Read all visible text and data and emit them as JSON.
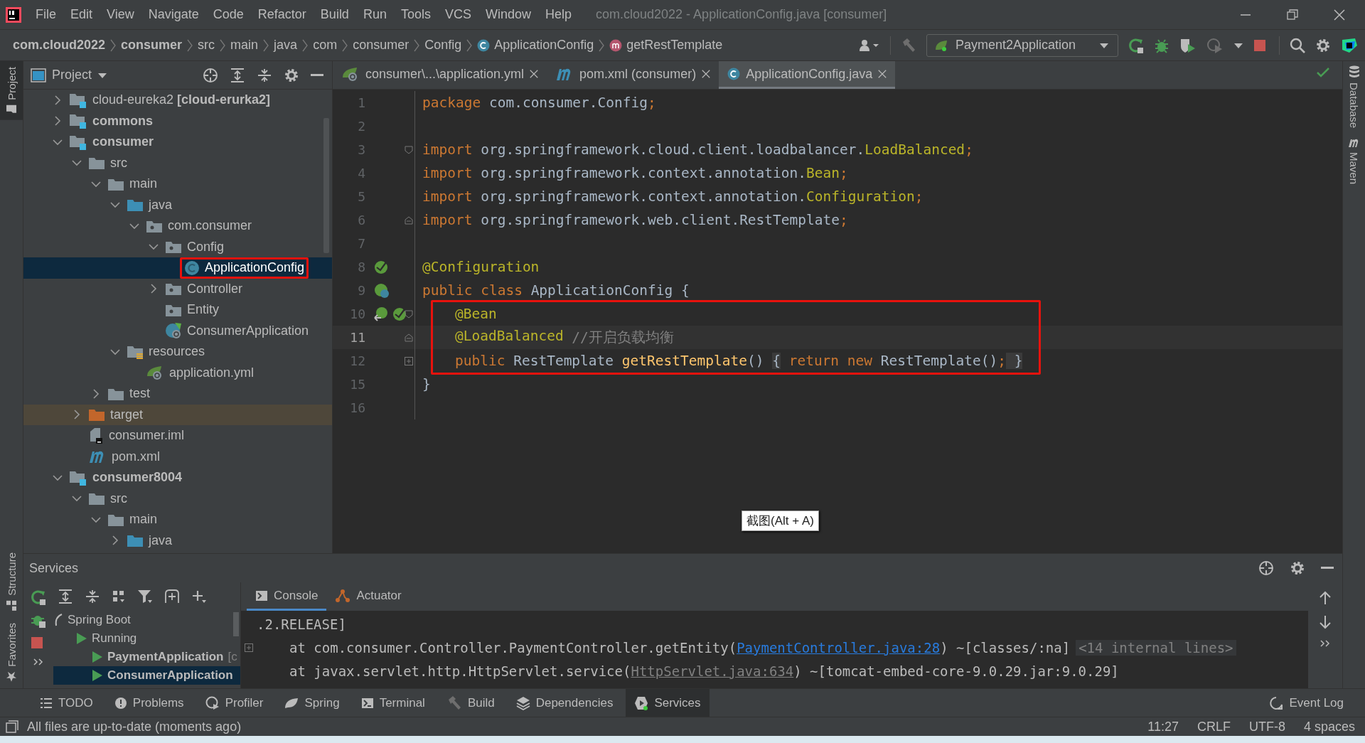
{
  "window": {
    "title": "com.cloud2022 - ApplicationConfig.java [consumer]"
  },
  "menu": [
    "File",
    "Edit",
    "View",
    "Navigate",
    "Code",
    "Refactor",
    "Build",
    "Run",
    "Tools",
    "VCS",
    "Window",
    "Help"
  ],
  "breadcrumbs": [
    {
      "label": "com.cloud2022",
      "kind": "module"
    },
    {
      "label": "consumer",
      "kind": "module"
    },
    {
      "label": "src",
      "kind": "dir"
    },
    {
      "label": "main",
      "kind": "dir"
    },
    {
      "label": "java",
      "kind": "dir"
    },
    {
      "label": "com",
      "kind": "dir"
    },
    {
      "label": "consumer",
      "kind": "dir"
    },
    {
      "label": "Config",
      "kind": "dir"
    },
    {
      "label": "ApplicationConfig",
      "kind": "class"
    },
    {
      "label": "getRestTemplate",
      "kind": "method"
    }
  ],
  "run_config": {
    "label": "Payment2Application"
  },
  "project_panel": {
    "title": "Project",
    "tree": [
      {
        "label": "cloud-eureka2 **[cloud-erurka2]**",
        "kind": "module",
        "bold": false,
        "expanded": false,
        "selected": false,
        "excluded": false,
        "marked": false
      },
      {
        "label": "commons",
        "kind": "module",
        "bold": true,
        "expanded": false,
        "selected": false,
        "excluded": false,
        "marked": false
      },
      {
        "label": "consumer",
        "kind": "module",
        "bold": true,
        "expanded": true,
        "selected": false,
        "excluded": false,
        "marked": false,
        "children": [
          {
            "label": "src",
            "kind": "folder",
            "bold": false,
            "expanded": true,
            "selected": false,
            "excluded": false,
            "marked": false,
            "children": [
              {
                "label": "main",
                "kind": "folder",
                "bold": false,
                "expanded": true,
                "selected": false,
                "excluded": false,
                "marked": false,
                "children": [
                  {
                    "label": "java",
                    "kind": "source",
                    "bold": false,
                    "expanded": true,
                    "selected": false,
                    "excluded": false,
                    "marked": false,
                    "children": [
                      {
                        "label": "com.consumer",
                        "kind": "package",
                        "bold": false,
                        "expanded": true,
                        "selected": false,
                        "excluded": false,
                        "marked": false,
                        "children": [
                          {
                            "label": "Config",
                            "kind": "package",
                            "bold": false,
                            "expanded": true,
                            "selected": false,
                            "excluded": false,
                            "marked": false,
                            "children": [
                              {
                                "label": "ApplicationConfig",
                                "kind": "class",
                                "bold": false,
                                "selected": true,
                                "excluded": false,
                                "marked": true
                              }
                            ]
                          },
                          {
                            "label": "Controller",
                            "kind": "package",
                            "bold": false,
                            "expanded": false,
                            "selected": false,
                            "excluded": false,
                            "marked": false
                          },
                          {
                            "label": "Entity",
                            "kind": "package",
                            "bold": false,
                            "selected": false,
                            "excluded": false,
                            "marked": false
                          },
                          {
                            "label": "ConsumerApplication",
                            "kind": "springclass",
                            "bold": false,
                            "selected": false,
                            "excluded": false,
                            "marked": false
                          }
                        ]
                      }
                    ]
                  },
                  {
                    "label": "resources",
                    "kind": "resources",
                    "bold": false,
                    "expanded": true,
                    "selected": false,
                    "excluded": false,
                    "marked": false,
                    "children": [
                      {
                        "label": "application.yml",
                        "kind": "yaml",
                        "bold": false,
                        "selected": false,
                        "excluded": false,
                        "marked": false
                      }
                    ]
                  }
                ]
              },
              {
                "label": "test",
                "kind": "folder",
                "bold": false,
                "expanded": false,
                "selected": false,
                "excluded": false,
                "marked": false
              }
            ]
          },
          {
            "label": "target",
            "kind": "target",
            "bold": false,
            "expanded": false,
            "selected": false,
            "excluded": true,
            "marked": false
          },
          {
            "label": "consumer.iml",
            "kind": "iml",
            "bold": false,
            "selected": false,
            "excluded": false,
            "marked": false
          },
          {
            "label": "pom.xml",
            "kind": "pom",
            "bold": false,
            "selected": false,
            "excluded": false,
            "marked": false
          }
        ]
      },
      {
        "label": "consumer8004",
        "kind": "module",
        "bold": true,
        "expanded": true,
        "selected": false,
        "excluded": false,
        "marked": false,
        "children": [
          {
            "label": "src",
            "kind": "folder",
            "bold": false,
            "expanded": true,
            "selected": false,
            "excluded": false,
            "marked": false,
            "children": [
              {
                "label": "main",
                "kind": "folder",
                "bold": false,
                "expanded": true,
                "selected": false,
                "excluded": false,
                "marked": false,
                "children": [
                  {
                    "label": "java",
                    "kind": "source",
                    "bold": false,
                    "expanded": false,
                    "selected": false,
                    "excluded": false,
                    "marked": false
                  }
                ]
              }
            ]
          }
        ]
      }
    ]
  },
  "editor": {
    "tabs": [
      {
        "label": "consumer\\...\\application.yml",
        "kind": "yaml",
        "selected": false
      },
      {
        "label": "pom.xml (consumer)",
        "kind": "pom",
        "selected": false
      },
      {
        "label": "ApplicationConfig.java",
        "kind": "class",
        "selected": true
      }
    ],
    "lines": [
      {
        "number": "1",
        "current": false,
        "boxed": false,
        "indented": false,
        "tokens": [
          {
            "text": "package",
            "kind": "keyword"
          },
          {
            "text": " com.consumer.Config",
            "kind": "plain"
          },
          {
            "text": ";",
            "kind": "keyword"
          }
        ]
      },
      {
        "number": "2",
        "current": false,
        "boxed": false
      },
      {
        "number": "3",
        "current": false,
        "boxed": false,
        "indented": false,
        "fold_start": true,
        "tokens": [
          {
            "text": "import",
            "kind": "keyword"
          },
          {
            "text": " org.springframework.cloud.client.loadbalancer.",
            "kind": "plain"
          },
          {
            "text": "LoadBalanced",
            "kind": "annotation"
          },
          {
            "text": ";",
            "kind": "keyword"
          }
        ]
      },
      {
        "number": "4",
        "current": false,
        "boxed": false,
        "indented": false,
        "tokens": [
          {
            "text": "import",
            "kind": "keyword"
          },
          {
            "text": " org.springframework.context.annotation.",
            "kind": "plain"
          },
          {
            "text": "Bean",
            "kind": "annotation"
          },
          {
            "text": ";",
            "kind": "keyword"
          }
        ]
      },
      {
        "number": "5",
        "current": false,
        "boxed": false,
        "indented": false,
        "tokens": [
          {
            "text": "import",
            "kind": "keyword"
          },
          {
            "text": " org.springframework.context.annotation.",
            "kind": "plain"
          },
          {
            "text": "Configuration",
            "kind": "annotation"
          },
          {
            "text": ";",
            "kind": "keyword"
          }
        ]
      },
      {
        "number": "6",
        "current": false,
        "boxed": false,
        "indented": false,
        "fold_end": true,
        "tokens": [
          {
            "text": "import",
            "kind": "keyword"
          },
          {
            "text": " org.springframework.web.client.RestTemplate",
            "kind": "plain"
          },
          {
            "text": ";",
            "kind": "keyword"
          }
        ]
      },
      {
        "number": "7",
        "current": false,
        "boxed": false
      },
      {
        "number": "8",
        "current": false,
        "boxed": false,
        "indented": false,
        "gutter": [
          {
            "kind": "bean"
          }
        ],
        "tokens": [
          {
            "text": "@Configuration",
            "kind": "annotation"
          }
        ]
      },
      {
        "number": "9",
        "current": false,
        "boxed": false,
        "indented": false,
        "gutter": [
          {
            "kind": "beanclass"
          }
        ],
        "tokens": [
          {
            "text": "public class",
            "kind": "keyword"
          },
          {
            "text": " ApplicationConfig {",
            "kind": "plain"
          }
        ]
      },
      {
        "number": "10",
        "current": false,
        "boxed": true,
        "indented": true,
        "fold_start": true,
        "gutter": [
          {
            "kind": "beanlink"
          },
          {
            "kind": "bean"
          }
        ],
        "tokens": [
          {
            "text": "@Bean",
            "kind": "annotation"
          }
        ]
      },
      {
        "number": "11",
        "current": true,
        "boxed": true,
        "indented": true,
        "fold_end": true,
        "tokens": [
          {
            "text": "@LoadBalanced",
            "kind": "annotation"
          },
          {
            "text": " //开启负载均衡",
            "kind": "comment"
          }
        ]
      },
      {
        "number": "12",
        "current": false,
        "boxed": true,
        "indented": true,
        "collapsed": true,
        "tokens": [
          {
            "text": "public",
            "kind": "keyword"
          },
          {
            "text": " RestTemplate ",
            "kind": "plain"
          },
          {
            "text": "getRestTemplate",
            "kind": "method"
          },
          {
            "text": "() ",
            "kind": "plain"
          },
          {
            "text": "{",
            "kind": "folded"
          },
          {
            "text": " return new",
            "kind": "keyword"
          },
          {
            "text": " RestTemplate()",
            "kind": "plain"
          },
          {
            "text": ";",
            "kind": "keyword"
          },
          {
            "text": " }",
            "kind": "folded"
          }
        ]
      },
      {
        "number": "15",
        "current": false,
        "boxed": false,
        "indented": false,
        "tokens": [
          {
            "text": "}",
            "kind": "plain"
          }
        ]
      },
      {
        "number": "16",
        "current": false,
        "boxed": false
      }
    ]
  },
  "tooltip": {
    "text": "截图(Alt + A)"
  },
  "services": {
    "title": "Services",
    "tabs": [
      {
        "label": "Console",
        "kind": "console",
        "selected": true
      },
      {
        "label": "Actuator",
        "kind": "actuator",
        "selected": false
      }
    ],
    "tree": [
      {
        "label": "Spring Boot",
        "kind": "spring",
        "bold": false,
        "selected": false,
        "children": [
          {
            "label": "Running",
            "kind": "running",
            "bold": false,
            "selected": false,
            "children": [
              {
                "label": "PaymentApplication",
                "detail": "[c",
                "kind": "app",
                "bold": true,
                "selected": false
              },
              {
                "label": "ConsumerApplication",
                "kind": "app",
                "bold": true,
                "selected": true
              }
            ]
          }
        ]
      }
    ],
    "console": [
      {
        "indented": false,
        "foldable": false,
        "tokens": [
          {
            "text": ".2.RELEASE]",
            "kind": "plain"
          }
        ]
      },
      {
        "indented": true,
        "foldable": true,
        "tokens": [
          {
            "text": "at com.consumer.Controller.PaymentController.getEntity(",
            "kind": "plain"
          },
          {
            "text": "PaymentController.java:28",
            "kind": "link"
          },
          {
            "text": ") ~[classes/:na]",
            "kind": "plain"
          },
          {
            "text": "<14 internal lines>",
            "kind": "folded"
          }
        ]
      },
      {
        "indented": true,
        "foldable": false,
        "tokens": [
          {
            "text": "at javax.servlet.http.HttpServlet.service(",
            "kind": "plain"
          },
          {
            "text": "HttpServlet.java:634",
            "kind": "mutedlink"
          },
          {
            "text": ") ~[tomcat-embed-core-9.0.29.jar:9.0.29]",
            "kind": "plain"
          }
        ]
      }
    ]
  },
  "tool_tabs": [
    {
      "label": "TODO",
      "kind": "todo",
      "selected": false
    },
    {
      "label": "Problems",
      "kind": "problems",
      "selected": false
    },
    {
      "label": "Profiler",
      "kind": "profiler",
      "selected": false
    },
    {
      "label": "Spring",
      "kind": "spring",
      "selected": false
    },
    {
      "label": "Terminal",
      "kind": "terminal",
      "selected": false
    },
    {
      "label": "Build",
      "kind": "build",
      "selected": false
    },
    {
      "label": "Dependencies",
      "kind": "deps",
      "selected": false
    },
    {
      "label": "Services",
      "kind": "services",
      "selected": true
    }
  ],
  "event_log": {
    "label": "Event Log"
  },
  "left_strip": [
    {
      "label": "Project",
      "selected": true
    },
    {
      "label": "Structure",
      "selected": false
    },
    {
      "label": "Favorites",
      "selected": false
    }
  ],
  "right_strip": [
    {
      "label": "Database",
      "kind": "db"
    },
    {
      "label": "Maven",
      "kind": "maven"
    }
  ],
  "status_bar": {
    "message": "All files are up-to-date (moments ago)",
    "items": [
      "11:27",
      "CRLF",
      "UTF-8",
      "4 spaces"
    ]
  }
}
